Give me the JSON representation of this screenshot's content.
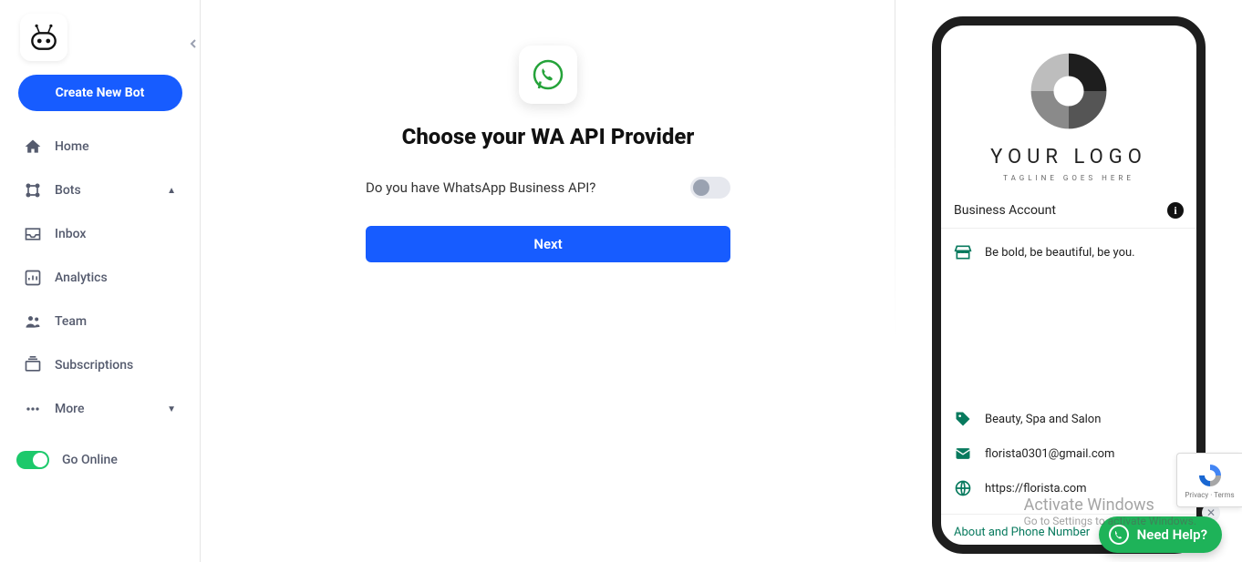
{
  "sidebar": {
    "create_label": "Create New Bot",
    "items": [
      {
        "label": "Home"
      },
      {
        "label": "Bots"
      },
      {
        "label": "Inbox"
      },
      {
        "label": "Analytics"
      },
      {
        "label": "Team"
      },
      {
        "label": "Subscriptions"
      },
      {
        "label": "More"
      }
    ],
    "online_label": "Go Online"
  },
  "setup": {
    "heading": "Choose your WA API Provider",
    "question": "Do you have WhatsApp Business API?",
    "next_label": "Next"
  },
  "preview": {
    "brand": "YOUR LOGO",
    "tagline": "TAGLINE GOES HERE",
    "biz_account": "Business Account",
    "bio": "Be bold, be beautiful, be you.",
    "category": "Beauty, Spa and Salon",
    "email": "florista0301@gmail.com",
    "website": "https://florista.com",
    "about_link": "About and Phone Number"
  },
  "help": {
    "label": "Need Help?"
  },
  "recaptcha": {
    "line": "Privacy · Terms"
  },
  "watermark": {
    "line1": "Activate Windows",
    "line2": "Go to Settings to activate Windows."
  }
}
